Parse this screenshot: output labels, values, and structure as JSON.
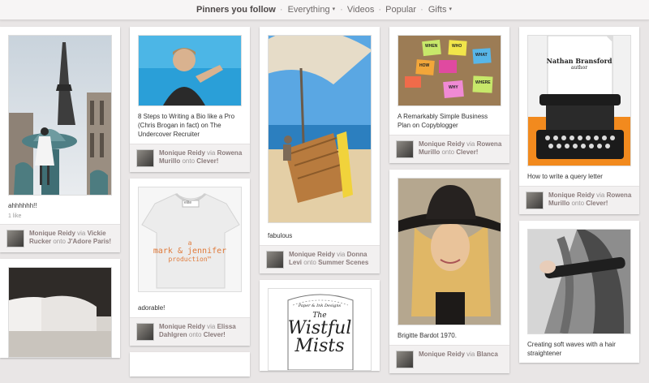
{
  "topnav": {
    "active": "Pinners you follow",
    "items": [
      {
        "label": "Everything",
        "caret": "▾"
      },
      {
        "label": "Videos",
        "caret": ""
      },
      {
        "label": "Popular",
        "caret": ""
      },
      {
        "label": "Gifts",
        "caret": "▾"
      }
    ],
    "separator": "·"
  },
  "pins": [
    {
      "caption": "ahhhhhh!!",
      "likes": "1 like",
      "user": "Monique Reidy",
      "via": "via",
      "via_user": "Vickie Rucker",
      "onto": "onto",
      "board": "J'Adore Paris!",
      "image": "paris-eiffel-tower"
    },
    {
      "caption": "",
      "likes": "",
      "user": "",
      "via": "",
      "via_user": "",
      "onto": "",
      "board": "",
      "image": "bedroom"
    },
    {
      "caption": "8 Steps to Writing a Bio like a Pro (Chris Brogan in fact) on The Undercover Recruiter",
      "user": "Monique Reidy",
      "via": "via",
      "via_user": "Rowena Murillo",
      "onto": "onto",
      "board": "Clever!",
      "image": "speaker"
    },
    {
      "caption": "adorable!",
      "user": "Monique Reidy",
      "via": "via",
      "via_user": "Elissa Dahlgren",
      "onto": "onto",
      "board": "Clever!",
      "image": "tshirt"
    },
    {
      "caption": "",
      "user": "",
      "image": "partial"
    },
    {
      "caption": "fabulous",
      "user": "Monique Reidy",
      "via": "via",
      "via_user": "Donna Levi",
      "onto": "onto",
      "board": "Summer Scenes",
      "image": "beach-chair"
    },
    {
      "caption": "",
      "user": "",
      "image": "wistful-mists"
    },
    {
      "caption": "A Remarkably Simple Business Plan on Copyblogger",
      "user": "Monique Reidy",
      "via": "via",
      "via_user": "Rowena Murillo",
      "onto": "onto",
      "board": "Clever!",
      "image": "sticky-notes"
    },
    {
      "caption": "Brigitte Bardot 1970.",
      "user": "Monique Reidy",
      "via": "via",
      "via_user": "Blanca",
      "onto": "",
      "board": "",
      "image": "hat-portrait"
    },
    {
      "caption": "How to write a query letter",
      "user": "Monique Reidy",
      "via": "via",
      "via_user": "Rowena Murillo",
      "onto": "onto",
      "board": "Clever!",
      "image": "typewriter"
    },
    {
      "caption": "Creating soft waves with a hair straightener",
      "user": "",
      "image": "hair-straightener"
    }
  ],
  "image_text": {
    "tshirt_line1": "a",
    "tshirt_line2": "mark & jennifer",
    "tshirt_line3": "production™",
    "tshirt_tag": "elite",
    "typewriter_name": "Nathan Bransford",
    "typewriter_role": "author",
    "wistful_small": "Paper & Ink Designs",
    "wistful_the": "The",
    "wistful_title1": "Wistful",
    "wistful_title2": "Mists",
    "notes": [
      "WHEN",
      "WHO",
      "WHAT",
      "HOW",
      "WHY",
      "WHERE"
    ]
  },
  "colors": {
    "background": "#e9e6e6",
    "link": "#8a7b7b",
    "card": "#ffffff",
    "attribution_bg": "#f2f0f0"
  }
}
